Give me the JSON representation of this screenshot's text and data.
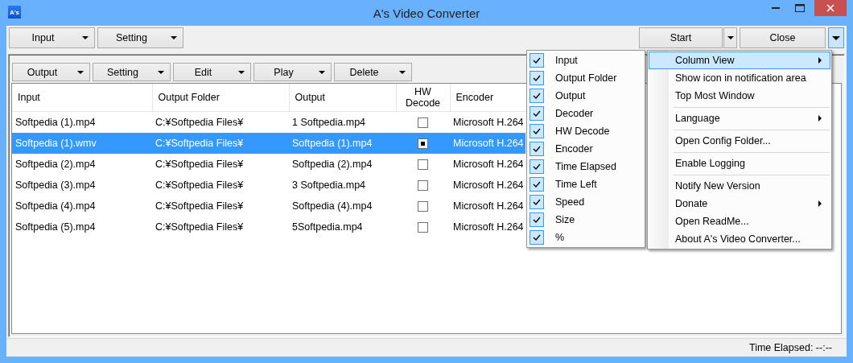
{
  "window": {
    "title": "A's Video Converter",
    "app_icon_text": "A's"
  },
  "top_toolbar": {
    "left": [
      {
        "label": "Input"
      },
      {
        "label": "Setting"
      }
    ],
    "right": [
      {
        "label": "Start",
        "split": true
      },
      {
        "label": "Close",
        "split": false
      }
    ],
    "menu_button": {
      "pressed": true
    }
  },
  "list_toolbar": [
    {
      "label": "Output"
    },
    {
      "label": "Setting"
    },
    {
      "label": "Edit"
    },
    {
      "label": "Play"
    },
    {
      "label": "Delete"
    }
  ],
  "table": {
    "columns": [
      "Input",
      "Output Folder",
      "Output",
      "HW Decode",
      "Encoder"
    ],
    "rows": [
      {
        "input": "Softpedia (1).mp4",
        "output_folder": "C:¥Softpedia Files¥",
        "output": "1 Softpedia.mp4",
        "hw_decode": false,
        "encoder": "Microsoft H.264",
        "selected": false
      },
      {
        "input": "Softpedia (1).wmv",
        "output_folder": "C:¥Softpedia Files¥",
        "output": "Softpedia (1).mp4",
        "hw_decode": true,
        "encoder": "Microsoft H.264",
        "selected": true
      },
      {
        "input": "Softpedia (2).mp4",
        "output_folder": "C:¥Softpedia Files¥",
        "output": "Softpedia (2).mp4",
        "hw_decode": false,
        "encoder": "Microsoft H.264",
        "selected": false
      },
      {
        "input": "Softpedia (3).mp4",
        "output_folder": "C:¥Softpedia Files¥",
        "output": "3 Softpedia.mp4",
        "hw_decode": false,
        "encoder": "Microsoft H.264",
        "selected": false
      },
      {
        "input": "Softpedia (4).mp4",
        "output_folder": "C:¥Softpedia Files¥",
        "output": "Softpedia (4).mp4",
        "hw_decode": false,
        "encoder": "Microsoft H.264",
        "selected": false
      },
      {
        "input": "Softpedia (5).mp4",
        "output_folder": "C:¥Softpedia Files¥",
        "output": "5Softpedia.mp4",
        "hw_decode": false,
        "encoder": "Microsoft H.264",
        "selected": false
      }
    ]
  },
  "column_view_menu": {
    "items": [
      {
        "label": "Input",
        "checked": true
      },
      {
        "label": "Output Folder",
        "checked": true
      },
      {
        "label": "Output",
        "checked": true
      },
      {
        "label": "Decoder",
        "checked": true
      },
      {
        "label": "HW Decode",
        "checked": true
      },
      {
        "label": "Encoder",
        "checked": true
      },
      {
        "label": "Time Elapsed",
        "checked": true
      },
      {
        "label": "Time Left",
        "checked": true
      },
      {
        "label": "Speed",
        "checked": true
      },
      {
        "label": "Size",
        "checked": true
      },
      {
        "label": "%",
        "checked": true
      }
    ]
  },
  "main_menu": {
    "items": [
      {
        "label": "Column View",
        "submenu": true,
        "selected": true,
        "separator_before": false
      },
      {
        "label": "Show icon in notification area",
        "submenu": false,
        "selected": false,
        "separator_before": false
      },
      {
        "label": "Top Most Window",
        "submenu": false,
        "selected": false,
        "separator_before": false
      },
      {
        "label": "Language",
        "submenu": true,
        "selected": false,
        "separator_before": true
      },
      {
        "label": "Open Config Folder...",
        "submenu": false,
        "selected": false,
        "separator_before": true
      },
      {
        "label": "Enable Logging",
        "submenu": false,
        "selected": false,
        "separator_before": true
      },
      {
        "label": "Notify New Version",
        "submenu": false,
        "selected": false,
        "separator_before": true
      },
      {
        "label": "Donate",
        "submenu": true,
        "selected": false,
        "separator_before": false
      },
      {
        "label": "Open ReadMe...",
        "submenu": false,
        "selected": false,
        "separator_before": false
      },
      {
        "label": "About A's Video Converter...",
        "submenu": false,
        "selected": false,
        "separator_before": false
      }
    ]
  },
  "status_bar": {
    "text": "Time Elapsed: --:--"
  }
}
